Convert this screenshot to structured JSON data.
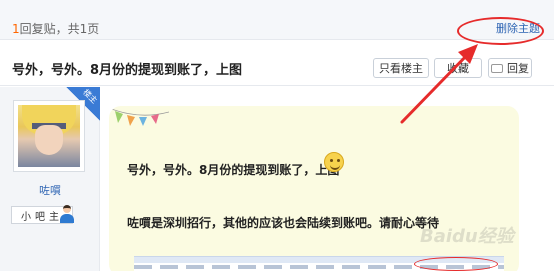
{
  "header": {
    "reply_count_num": "1",
    "reply_count_text": "回复贴，共1页",
    "delete_topic": "删除主题"
  },
  "post": {
    "title": "号外，号外。8月份的提现到账了，上图",
    "buttons": {
      "only_op": "只看楼主",
      "favorite": "收藏",
      "reply": "回复"
    }
  },
  "author": {
    "name": "咗嘪",
    "op_badge": "楼主",
    "level": "小吧主"
  },
  "content": {
    "line1": "号外，号外。8月份的提现到账了，上图",
    "line2": "咗嘪是深圳招行，其他的应该也会陆续到账吧。请耐心等待"
  },
  "annotations": {
    "highlight_color": "#e62b2b"
  },
  "watermark": "Baidu经验"
}
